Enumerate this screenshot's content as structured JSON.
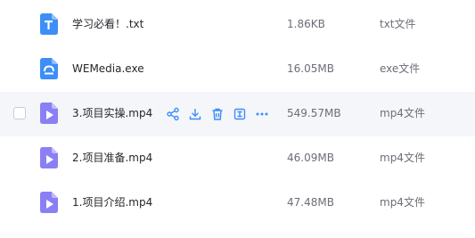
{
  "files": [
    {
      "name": "学习必看！.txt",
      "size": "1.86KB",
      "type": "txt文件",
      "icon": "txt-file-icon",
      "icon_color": "#3d8ef7"
    },
    {
      "name": "WEMedia.exe",
      "size": "16.05MB",
      "type": "exe文件",
      "icon": "exe-file-icon",
      "icon_color": "#3d8ef7"
    },
    {
      "name": "3.项目实操.mp4",
      "size": "549.57MB",
      "type": "mp4文件",
      "icon": "video-file-icon",
      "icon_color": "#8b7ff5"
    },
    {
      "name": "2.项目准备.mp4",
      "size": "46.09MB",
      "type": "mp4文件",
      "icon": "video-file-icon",
      "icon_color": "#8b7ff5"
    },
    {
      "name": "1.项目介绍.mp4",
      "size": "47.48MB",
      "type": "mp4文件",
      "icon": "video-file-icon",
      "icon_color": "#8b7ff5"
    }
  ],
  "hover_actions": [
    "share-icon",
    "download-icon",
    "delete-icon",
    "details-icon",
    "more-icon"
  ],
  "colors": {
    "accent": "#3d8ef7",
    "row_hover": "#f5f6fa"
  }
}
